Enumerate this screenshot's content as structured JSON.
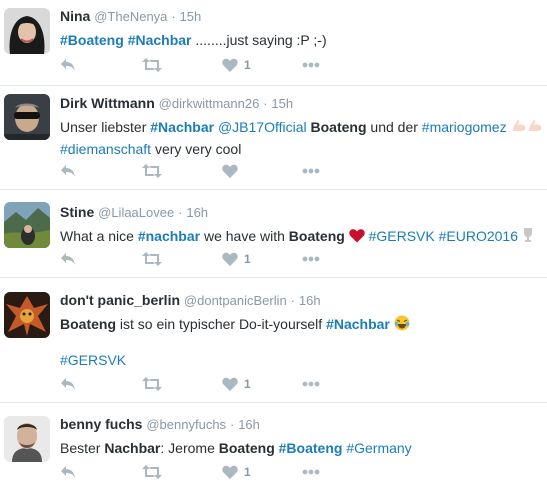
{
  "tweets": [
    {
      "name": "Nina",
      "handle": "@TheNenya",
      "sep": "·",
      "time": "15h",
      "text": {
        "tag1": "#Boateng",
        "tag2": "#Nachbar",
        "rest": " ........just saying :P ;-)"
      },
      "like_count": "1"
    },
    {
      "name": "Dirk Wittmann",
      "handle": "@dirkwittmann26",
      "sep": "·",
      "time": "15h",
      "text": {
        "p1": "Unser liebster ",
        "tag1": "#Nachbar",
        "p2": " ",
        "mention": "@JB17Official",
        "p3": " ",
        "bold1": "Boateng",
        "p4": " und der ",
        "tag2": "#mariogomez",
        "line2_tag": "#diemanschaft",
        "line2_rest": " very very cool"
      },
      "like_count": ""
    },
    {
      "name": "Stine",
      "handle": "@LilaaLovee",
      "sep": "·",
      "time": "16h",
      "text": {
        "p1": "What a nice ",
        "tag1": "#nachbar",
        "p2": " we have with ",
        "bold1": "Boateng",
        "tag2": "#GERSVK",
        "tag3": "#EURO2016"
      },
      "like_count": "1"
    },
    {
      "name": "don't panic_berlin",
      "handle": "@dontpanicBerlin",
      "sep": "·",
      "time": "16h",
      "text": {
        "bold1": "Boateng",
        "p1": " ist so ein typischer Do-it-yourself ",
        "tag1": "#Nachbar",
        "line2_tag": "#GERSVK"
      },
      "like_count": "1"
    },
    {
      "name": "benny fuchs",
      "handle": "@bennyfuchs",
      "sep": "·",
      "time": "16h",
      "text": {
        "p1": "Bester ",
        "bold1": "Nachbar",
        "p2": ": Jerome ",
        "bold2": "Boateng",
        "p3": " ",
        "tag1": "#Boateng",
        "p4": " ",
        "tag2": "#Germany"
      },
      "like_count": "1"
    }
  ],
  "icons": [
    "reply-icon",
    "retweet-icon",
    "like-icon",
    "more-icon"
  ],
  "colors": {
    "link": "#1b7db8",
    "muted": "#8899a6",
    "icon": "#aab8c2",
    "heart_emoji": "#c8102e"
  }
}
